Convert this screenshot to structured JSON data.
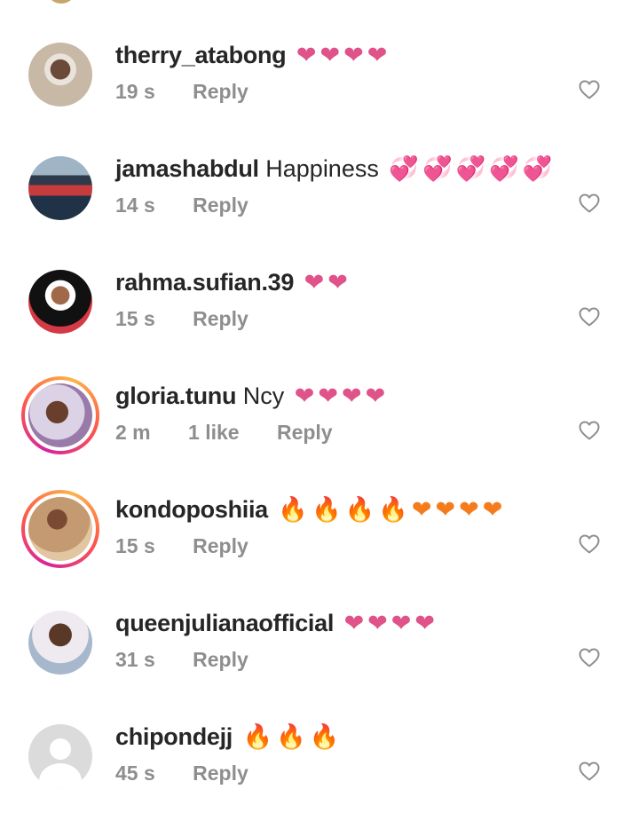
{
  "comments": [
    {
      "username": "therry_atabong",
      "message": "",
      "emojis": "❤❤❤❤",
      "emoji_style": "heart",
      "time": "19 s",
      "likes": "",
      "reply": "Reply",
      "avatar": "photo-woman-glasses",
      "story_ring": false
    },
    {
      "username": "jamashabdul",
      "message": "Happiness",
      "emojis": "💞💞💞💞💞",
      "emoji_style": "heart",
      "time": "14 s",
      "likes": "",
      "reply": "Reply",
      "avatar": "photo-man-red-jacket",
      "story_ring": false
    },
    {
      "username": "rahma.sufian.39",
      "message": "",
      "emojis": "❤❤",
      "emoji_style": "heart",
      "time": "15 s",
      "likes": "",
      "reply": "Reply",
      "avatar": "photo-woman-hijab",
      "story_ring": false
    },
    {
      "username": "gloria.tunu",
      "message": "Ncy",
      "emojis": "❤❤❤❤",
      "emoji_style": "heart",
      "time": "2 m",
      "likes": "1 like",
      "reply": "Reply",
      "avatar": "photo-woman-lying",
      "story_ring": true
    },
    {
      "username": "kondoposhiia",
      "message": "",
      "emojis": "🔥🔥🔥🔥❤❤❤❤",
      "emoji_style": "fire-heart",
      "time": "15 s",
      "likes": "",
      "reply": "Reply",
      "avatar": "photo-woman-dress",
      "story_ring": true
    },
    {
      "username": "queenjulianaofficial",
      "message": "",
      "emojis": "❤❤❤❤",
      "emoji_style": "heart",
      "time": "31 s",
      "likes": "",
      "reply": "Reply",
      "avatar": "photo-woman-selfie",
      "story_ring": false
    },
    {
      "username": "chipondejj",
      "message": "",
      "emojis": "🔥🔥🔥",
      "emoji_style": "fire",
      "time": "45 s",
      "likes": "",
      "reply": "Reply",
      "avatar": "default-avatar",
      "story_ring": false
    }
  ],
  "colors": {
    "text": "#262626",
    "meta": "#8e8e8e",
    "heart_emoji": "#e0528a",
    "fire_emoji": "#f57c1c",
    "like_icon": "#8e8e8e"
  },
  "icons": {
    "like": "heart-outline-icon"
  }
}
